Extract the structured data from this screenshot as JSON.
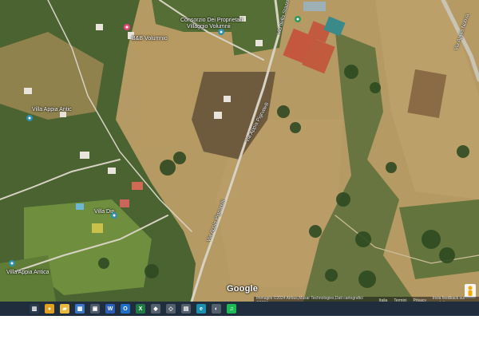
{
  "map": {
    "place_labels": [
      {
        "id": "consorzio",
        "text": "Consorzio Dei Proprietari"
      },
      {
        "id": "consorzio2",
        "text": "Villaggio Volumnii"
      },
      {
        "id": "bb",
        "text": "B&B Volumnio"
      },
      {
        "id": "appia1",
        "text": "Villa Appia Antic"
      },
      {
        "id": "villa",
        "text": "Villa Din"
      },
      {
        "id": "appia2",
        "text": "Villa Appia Antica"
      }
    ],
    "road_labels": [
      {
        "id": "r1",
        "text": "Via Appia Pignatelli"
      },
      {
        "id": "r2",
        "text": "Via Appia Pignatelli"
      },
      {
        "id": "r3",
        "text": "Via Appia Nuova"
      },
      {
        "id": "r4",
        "text": "Via della Stazione"
      }
    ],
    "logo": "Google",
    "attribution": {
      "copyright": "Immagini ©2024 Airbus,Maxar Technologies,Dati cartografici ©2024",
      "links": [
        "Italia",
        "Termini",
        "Privacy",
        "Invia feedback sul prodotto"
      ]
    },
    "colors": {
      "dry_field": "#b59a63",
      "dark_field": "#8c7144",
      "vegetation": "#3d5a2a",
      "lawn": "#6f8f3f",
      "tennis_court": "#c4573d",
      "road": "#d8d2c4"
    }
  },
  "taskbar": {
    "background": "#1f2d3d",
    "icons": [
      {
        "name": "task-view-icon",
        "glyph": "▥",
        "color": "#2b3a4d"
      },
      {
        "name": "chrome-icon",
        "glyph": "●",
        "color": "#e0a020"
      },
      {
        "name": "file-explorer-icon",
        "glyph": "▰",
        "color": "#e8b93a"
      },
      {
        "name": "store-icon",
        "glyph": "▦",
        "color": "#3a78c4"
      },
      {
        "name": "camera-icon",
        "glyph": "▣",
        "color": "#4d5b6b"
      },
      {
        "name": "word-icon",
        "glyph": "W",
        "color": "#2b5fb8"
      },
      {
        "name": "outlook-icon",
        "glyph": "O",
        "color": "#1e6fc8"
      },
      {
        "name": "excel-icon",
        "glyph": "X",
        "color": "#1f7a44"
      },
      {
        "name": "app-icon-1",
        "glyph": "◆",
        "color": "#55606e"
      },
      {
        "name": "app-icon-2",
        "glyph": "◇",
        "color": "#55606e"
      },
      {
        "name": "app-icon-3",
        "glyph": "▤",
        "color": "#55606e"
      },
      {
        "name": "edge-icon",
        "glyph": "e",
        "color": "#1b8fb0"
      },
      {
        "name": "app-icon-4",
        "glyph": "◐",
        "color": "#55606e"
      },
      {
        "name": "spotify-icon",
        "glyph": "♫",
        "color": "#1db954"
      }
    ]
  }
}
